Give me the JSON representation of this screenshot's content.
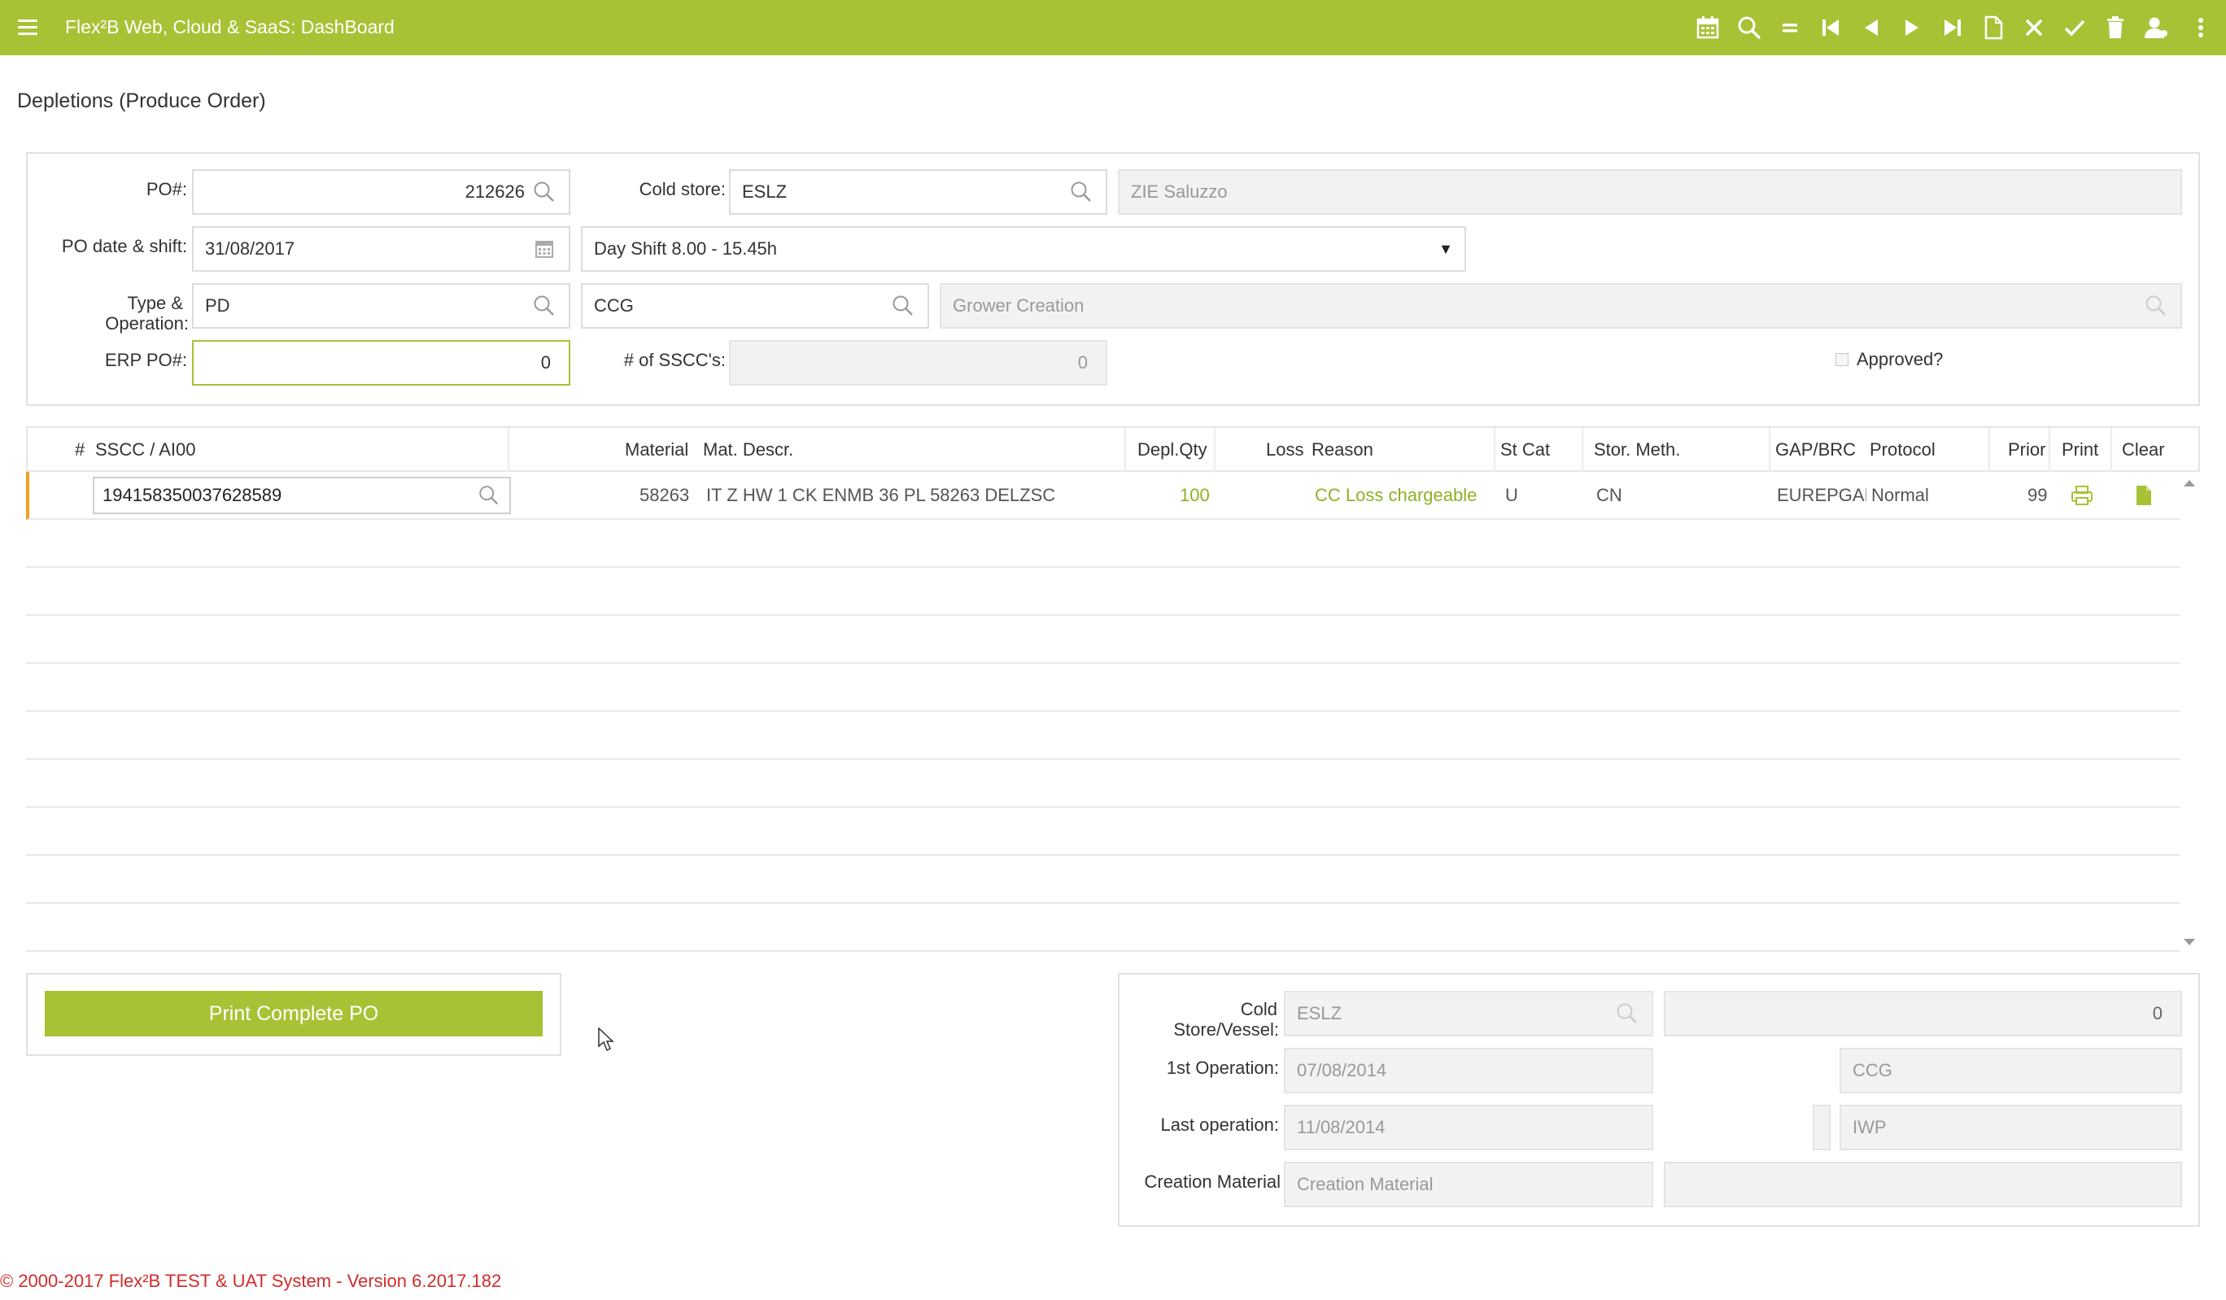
{
  "app": {
    "title": "Flex²B Web, Cloud & SaaS: DashBoard",
    "accent_color": "#a8c236",
    "toolbar_icons": [
      "calendar-icon",
      "search-icon",
      "equals-icon",
      "first-record-icon",
      "previous-record-icon",
      "next-record-icon",
      "last-record-icon",
      "new-document-icon",
      "cancel-icon",
      "confirm-icon",
      "delete-icon",
      "user-icon",
      "more-vertical-icon"
    ]
  },
  "page": {
    "title": "Depletions (Produce Order)"
  },
  "header_form": {
    "po_label": "PO#:",
    "po_value": "212626",
    "cold_store_label": "Cold store:",
    "cold_store_value": "ESLZ",
    "cold_store_name": "ZIE Saluzzo",
    "po_date_label": "PO date & shift:",
    "po_date_value": "31/08/2017",
    "shift_value": "Day Shift 8.00 - 15.45h",
    "type_label_1": "Type &",
    "type_label_2": "Operation:",
    "type_value": "PD",
    "operation_value": "CCG",
    "operation_desc": "Grower Creation",
    "erp_po_label": "ERP PO#:",
    "erp_po_value": "0",
    "sscc_count_label": "# of SSCC's:",
    "sscc_count_value": "0",
    "approved_label": "Approved?",
    "approved": false
  },
  "grid": {
    "columns": [
      "#",
      "SSCC / AI00",
      "Material",
      "Mat. Descr.",
      "Depl.Qty",
      "Loss",
      "Reason",
      "St Cat",
      "Stor. Meth.",
      "GAP/BRC",
      "Protocol",
      "Prior",
      "Print",
      "Clear"
    ],
    "rows": [
      {
        "sscc": "194158350037628589",
        "material": "58263",
        "mat_descr": "IT Z HW 1 CK ENMB 36 PL 58263 DELZSC",
        "depl_qty": "100",
        "loss": "",
        "reason": "CC Loss chargeable",
        "st_cat": "U",
        "stor_meth": "CN",
        "gap_brc": "EUREPGAP",
        "protocol": "Normal",
        "prior": "99"
      }
    ],
    "empty_rows": 9
  },
  "actions": {
    "print_complete_po": "Print Complete PO"
  },
  "details": {
    "cold_store_vessel_label_1": "Cold",
    "cold_store_vessel_label_2": "Store/Vessel:",
    "cold_store_vessel_value": "ESLZ",
    "cold_store_vessel_number": "0",
    "first_operation_label": "1st Operation:",
    "first_operation_date": "07/08/2014",
    "first_operation_code": "CCG",
    "last_operation_label": "Last operation:",
    "last_operation_date": "11/08/2014",
    "last_operation_code": "IWP",
    "creation_material_label": "Creation Material",
    "creation_material_placeholder": "Creation Material",
    "creation_material_desc": ""
  },
  "footer": {
    "copyright": "© 2000-2017 Flex²B TEST & UAT System - Version 6.2017.182"
  }
}
